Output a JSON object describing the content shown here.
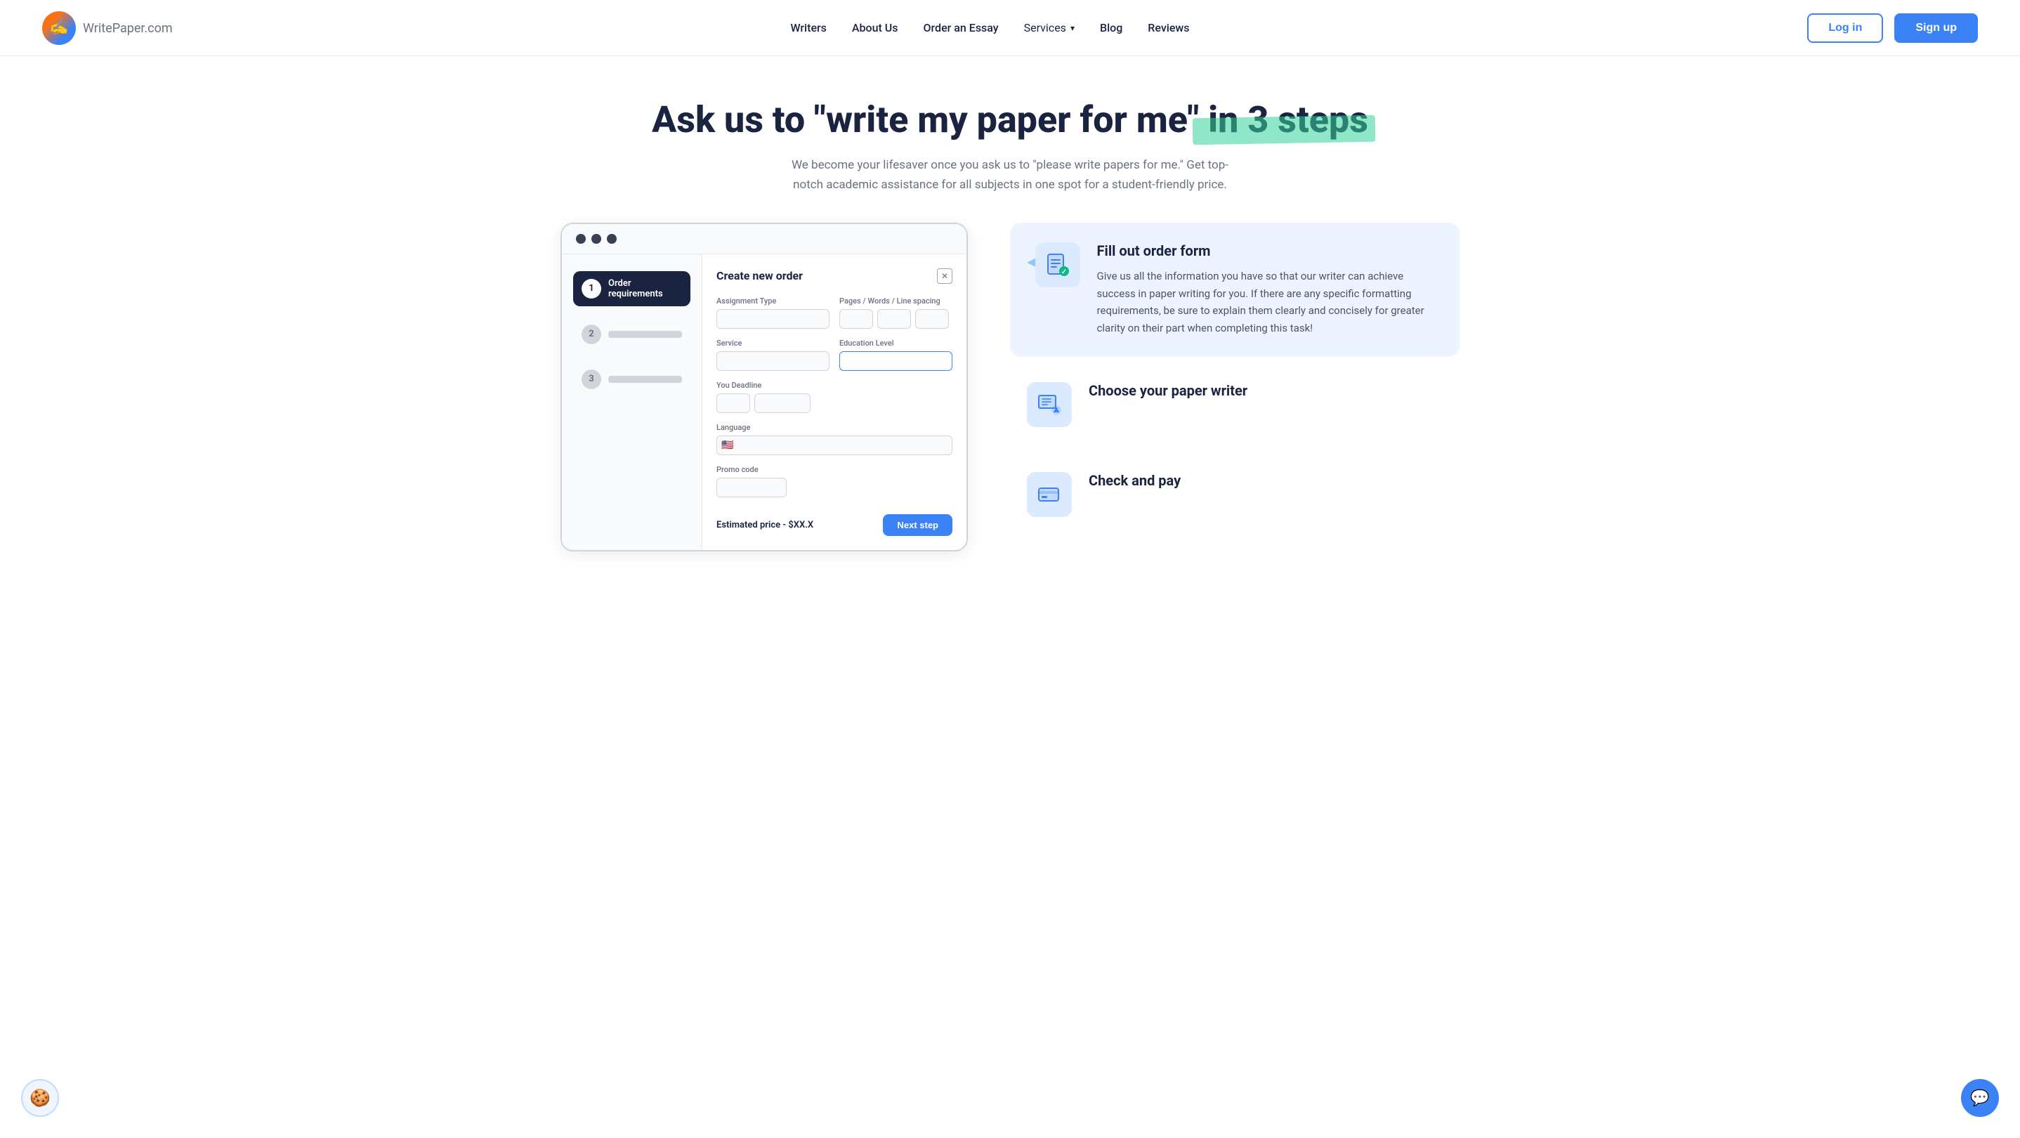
{
  "nav": {
    "logo_text": "WritePaper",
    "logo_domain": ".com",
    "links": [
      {
        "label": "Writers",
        "href": "#"
      },
      {
        "label": "About Us",
        "href": "#"
      },
      {
        "label": "Order an Essay",
        "href": "#"
      },
      {
        "label": "Services",
        "href": "#"
      },
      {
        "label": "Blog",
        "href": "#"
      },
      {
        "label": "Reviews",
        "href": "#"
      }
    ],
    "login_label": "Log in",
    "signup_label": "Sign up"
  },
  "hero": {
    "title_part1": "Ask us to \"write my paper for me\" in ",
    "title_highlight": "3 steps",
    "subtitle": "We become your lifesaver once you ask us to \"please write papers for me.\" Get top-notch academic assistance for all subjects in one spot for a student-friendly price."
  },
  "order_form": {
    "title": "Create new order",
    "steps": [
      {
        "num": "1",
        "label": "Order requirements",
        "active": true
      },
      {
        "num": "2",
        "label": "",
        "active": false
      },
      {
        "num": "3",
        "label": "",
        "active": false
      }
    ],
    "fields": {
      "assignment_type_label": "Assignment Type",
      "pages_label": "Pages / Words / Line spacing",
      "service_label": "Service",
      "education_level_label": "Education Level",
      "deadline_label": "You Deadline",
      "language_label": "Language",
      "promo_label": "Promo code"
    },
    "estimated_label": "Estimated price",
    "estimated_value": "- $XX.X",
    "next_btn": "Next step"
  },
  "steps_info": [
    {
      "id": "fill-form",
      "title": "Fill out order form",
      "description": "Give us all the information you have so that our writer can achieve success in paper writing for you. If there are any specific formatting requirements, be sure to explain them clearly and concisely for greater clarity on their part when completing this task!",
      "highlighted": true
    },
    {
      "id": "choose-writer",
      "title": "Choose your paper writer",
      "description": "",
      "highlighted": false
    },
    {
      "id": "check-pay",
      "title": "Check and pay",
      "description": "",
      "highlighted": false
    }
  ],
  "cookie": {
    "icon": "🍪"
  },
  "chat": {
    "icon": "💬"
  }
}
